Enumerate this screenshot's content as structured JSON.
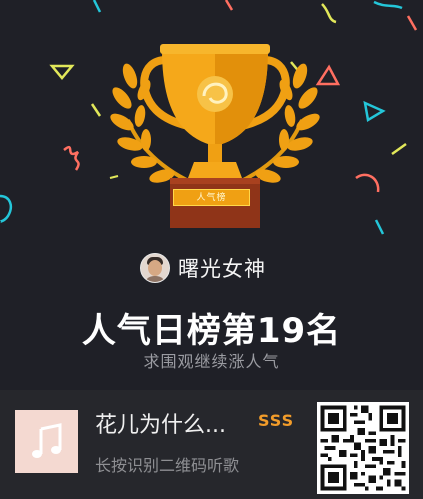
{
  "badge": {
    "label": "人气榜"
  },
  "user": {
    "name": "曙光女神"
  },
  "rank": {
    "title": "人气日榜第19名",
    "subtitle": "求围观继续涨人气"
  },
  "song": {
    "title": "花儿为什么...",
    "quality_badge": "SSS",
    "hint": "长按识别二维码听歌"
  },
  "icons": {
    "trophy": "trophy-icon",
    "laurel": "laurel-icon",
    "music_note": "music-note-icon",
    "qr_code": "qr-code-icon"
  },
  "colors": {
    "background": "#1f2027",
    "gold": "#f0a013",
    "quality": "#f29c2a",
    "bottom_bar": "#26272c"
  }
}
